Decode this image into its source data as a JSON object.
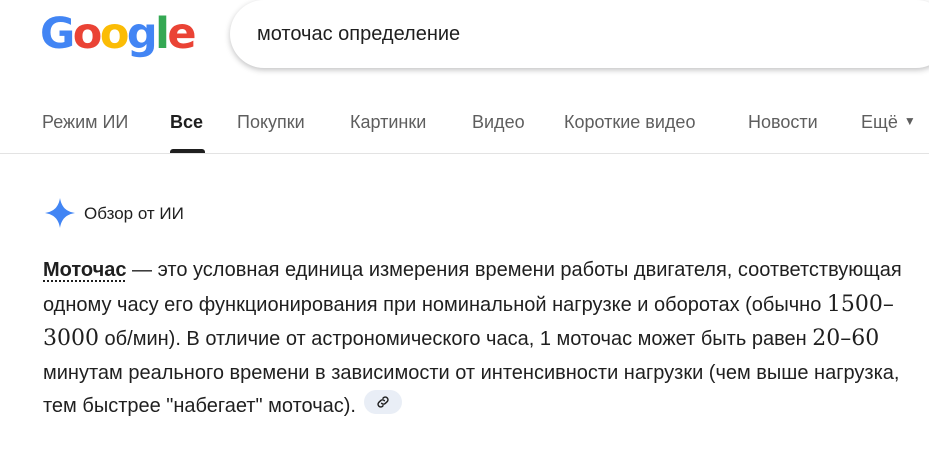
{
  "logo": {
    "letters": [
      "G",
      "o",
      "o",
      "g",
      "l",
      "e"
    ],
    "colors": [
      "#4285F4",
      "#EA4335",
      "#FBBC05",
      "#4285F4",
      "#34A853",
      "#EA4335"
    ]
  },
  "search": {
    "query": "моточас определение"
  },
  "tabs": [
    {
      "label": "Режим ИИ"
    },
    {
      "label": "Все",
      "active": true
    },
    {
      "label": "Покупки"
    },
    {
      "label": "Картинки"
    },
    {
      "label": "Видео"
    },
    {
      "label": "Короткие видео"
    },
    {
      "label": "Новости"
    },
    {
      "label": "Ещё"
    }
  ],
  "ai_overview": {
    "title": "Обзор от ИИ",
    "sparkle_color": "#4285F4",
    "term": "Моточас",
    "seg1": " — это условная единица измерения времени работы двигателя, соответствующая одному часу его функционирования при номинальной нагрузке и оборотах (обычно ",
    "range1": "1500–3000",
    "seg2": " об/мин). В отличие от астрономического часа, 1 моточас может быть равен ",
    "range2": "20–60",
    "seg3": " минутам реального времени в зависимости от интенсивности нагрузки (чем выше нагрузка, тем быстрее \"набегает\" моточас).",
    "link_icon": "link-icon"
  }
}
